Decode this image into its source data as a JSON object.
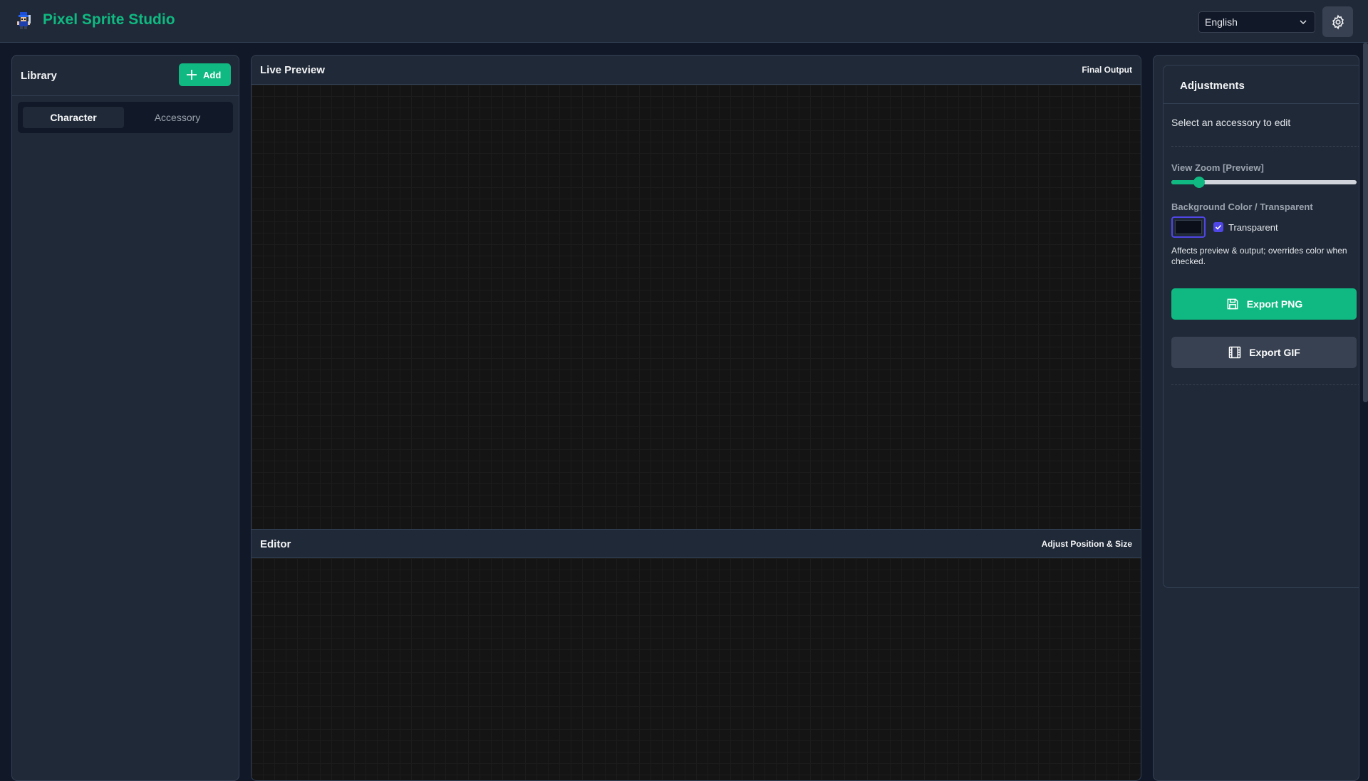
{
  "header": {
    "app_title": "Pixel Sprite Studio",
    "language": "English",
    "icons": {
      "logo": "pixel-character-logo",
      "settings": "gear-icon",
      "dropdown": "chevron-down-icon"
    }
  },
  "library": {
    "title": "Library",
    "add_label": "Add",
    "tabs": [
      {
        "label": "Character",
        "active": true
      },
      {
        "label": "Accessory",
        "active": false
      }
    ]
  },
  "preview": {
    "title": "Live Preview",
    "subtitle": "Final Output"
  },
  "editor": {
    "title": "Editor",
    "subtitle": "Adjust Position & Size"
  },
  "adjustments": {
    "title": "Adjustments",
    "hint": "Select an accessory to edit",
    "zoom_label": "View Zoom [Preview]",
    "zoom_level": 0.15,
    "bg_label": "Background Color / Transparent",
    "transparent_label": "Transparent",
    "transparent_checked": true,
    "note": "Affects preview & output; overrides color when checked.",
    "export_png": "Export PNG",
    "export_gif": "Export GIF"
  },
  "colors": {
    "accent": "#10b981",
    "background": "#111827",
    "panel": "#1f2937",
    "check": "#4f46e5"
  }
}
